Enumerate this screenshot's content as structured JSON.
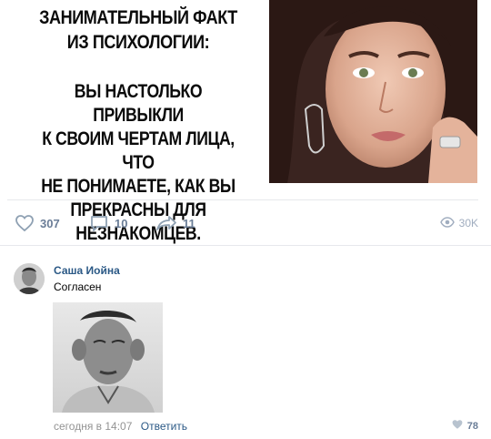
{
  "meme": {
    "title_line1": "ЗАНИМАТЕЛЬНЫЙ ФАКТ",
    "title_line2": "ИЗ ПСИХОЛОГИИ:",
    "body_lines": [
      "ВЫ НАСТОЛЬКО ПРИВЫКЛИ",
      "К СВОИМ ЧЕРТАМ ЛИЦА, ЧТО",
      "НЕ ПОНИМАЕТЕ, КАК ВЫ",
      "ПРЕКРАСНЫ ДЛЯ НЕЗНАКОМЦЕВ."
    ]
  },
  "actions": {
    "likes": "307",
    "comments": "10",
    "shares": "11",
    "views": "30K"
  },
  "comment": {
    "author": "Саша Иойна",
    "text": "Согласен",
    "time": "сегодня в 14:07",
    "reply_label": "Ответить",
    "likes": "78"
  },
  "colors": {
    "link": "#2a5885",
    "action": "#6a7d97",
    "muted": "#939393",
    "separator": "#e7e8ec"
  }
}
